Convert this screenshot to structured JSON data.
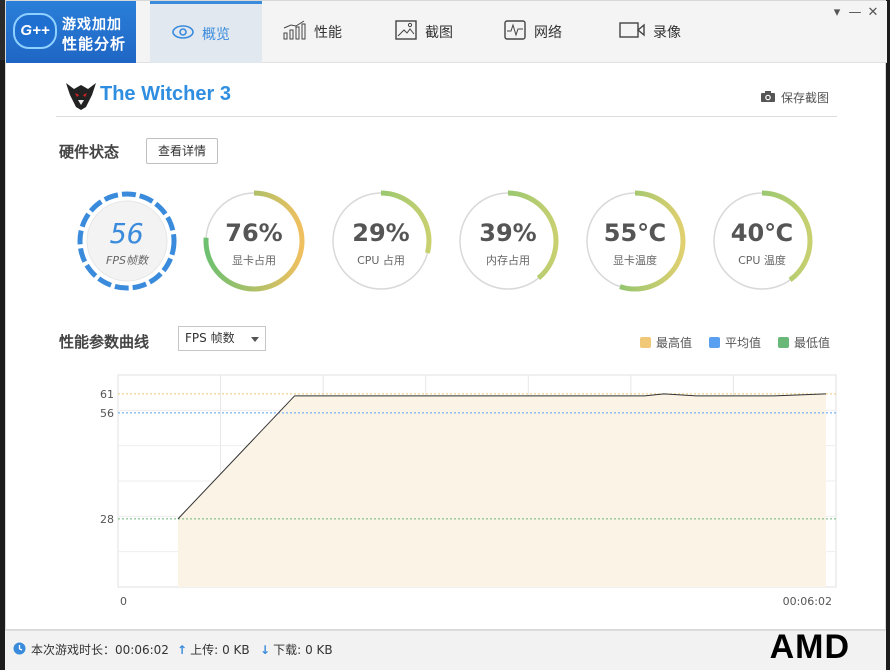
{
  "brand": {
    "logo_text": "G++",
    "line1": "游戏加加",
    "line2": "性能分析",
    "color": "#2a7fd8"
  },
  "tabs": [
    {
      "label": "概览",
      "icon": "eye-icon",
      "active": true
    },
    {
      "label": "性能",
      "icon": "bar-chart-icon",
      "active": false
    },
    {
      "label": "截图",
      "icon": "image-icon",
      "active": false
    },
    {
      "label": "网络",
      "icon": "pulse-icon",
      "active": false
    },
    {
      "label": "录像",
      "icon": "video-icon",
      "active": false
    }
  ],
  "window_controls": {
    "menu": "▾",
    "minimize": "—",
    "close": "✕"
  },
  "game": {
    "title": "The Witcher 3",
    "save_screenshot": "保存截图"
  },
  "hardware": {
    "section_title": "硬件状态",
    "details_button": "查看详情",
    "fps": {
      "value": "56",
      "label": "FPS帧数"
    },
    "gauges": [
      {
        "value": "76%",
        "label": "显卡占用",
        "level": 0.76
      },
      {
        "value": "29%",
        "label": "CPU 占用",
        "level": 0.29
      },
      {
        "value": "39%",
        "label": "内存占用",
        "level": 0.39
      },
      {
        "value": "55℃",
        "label": "显卡温度",
        "level": 0.55
      },
      {
        "value": "40℃",
        "label": "CPU 温度",
        "level": 0.4
      }
    ]
  },
  "curve": {
    "section_title": "性能参数曲线",
    "select_value": "FPS 帧数",
    "legend": [
      {
        "label": "最高值",
        "color": "#f0c878"
      },
      {
        "label": "平均值",
        "color": "#5aa0f0"
      },
      {
        "label": "最低值",
        "color": "#6ab878"
      }
    ]
  },
  "chart_data": {
    "type": "line",
    "x_start_label": "0",
    "x_end_label": "00:06:02",
    "y_ticks": [
      28,
      56,
      61
    ],
    "max_line": 61,
    "avg_line": 56,
    "min_line": 28,
    "ylim": [
      10,
      66
    ],
    "points": [
      {
        "t": 0,
        "v": 28
      },
      {
        "t": 0.18,
        "v": 60.5
      },
      {
        "t": 0.3,
        "v": 60.5
      },
      {
        "t": 0.55,
        "v": 60.5
      },
      {
        "t": 0.72,
        "v": 60.5
      },
      {
        "t": 0.75,
        "v": 61
      },
      {
        "t": 0.8,
        "v": 60.5
      },
      {
        "t": 0.92,
        "v": 60.5
      },
      {
        "t": 1.0,
        "v": 61
      }
    ],
    "colors": {
      "line": "#333333",
      "fill": "#faf3e6",
      "max": "#f0c878",
      "avg": "#5aa0f0",
      "min": "#6ab878"
    }
  },
  "status": {
    "play_time_label": "本次游戏时长：",
    "play_time": "00:06:02",
    "upload_label": "上传:",
    "upload": "0 KB",
    "download_label": "下载:",
    "download": "0 KB"
  },
  "watermark": "AMD"
}
